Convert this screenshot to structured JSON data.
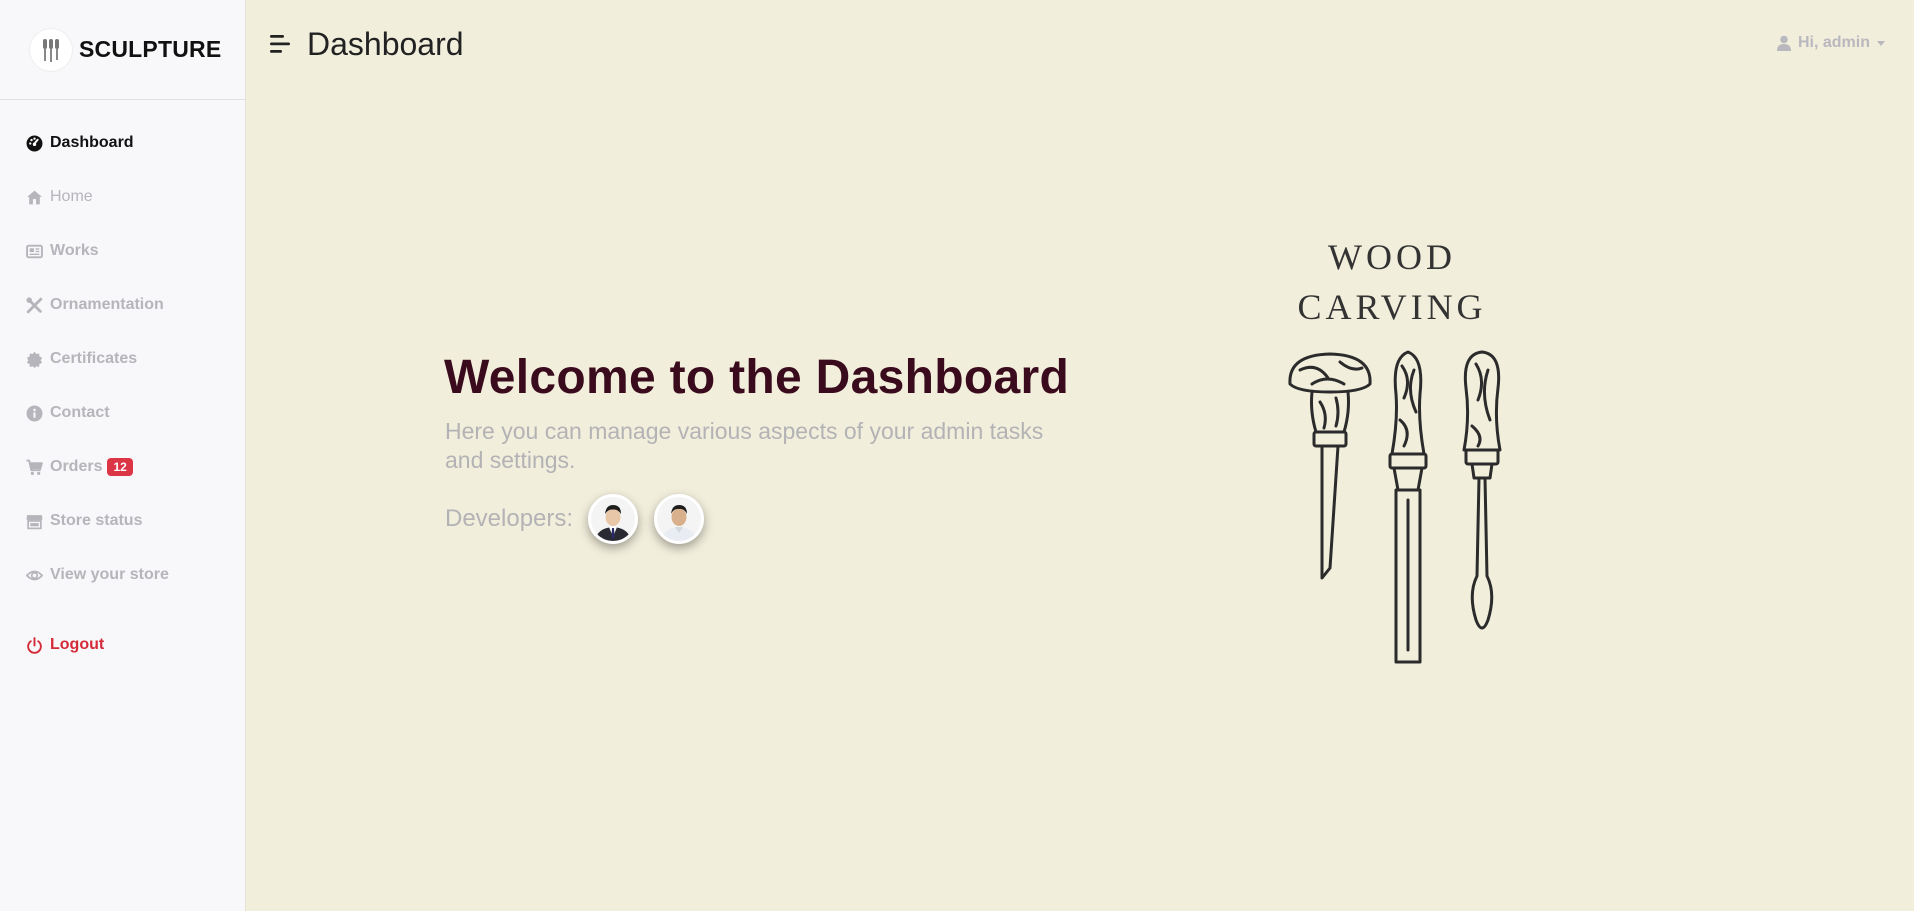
{
  "brand": {
    "name": "SCULPTURE"
  },
  "sidebar": {
    "items": [
      {
        "label": "Dashboard",
        "icon": "gauge-icon"
      },
      {
        "label": "Home",
        "icon": "home-icon"
      },
      {
        "label": "Works",
        "icon": "newspaper-icon"
      },
      {
        "label": "Ornamentation",
        "icon": "tools-icon"
      },
      {
        "label": "Certificates",
        "icon": "certificate-icon"
      },
      {
        "label": "Contact",
        "icon": "info-icon"
      },
      {
        "label": "Orders",
        "icon": "cart-icon",
        "badge": "12"
      },
      {
        "label": "Store status",
        "icon": "store-icon"
      },
      {
        "label": "View your store",
        "icon": "eye-icon"
      }
    ],
    "logout": {
      "label": "Logout",
      "icon": "power-icon"
    }
  },
  "header": {
    "title": "Dashboard",
    "user_greeting": "Hi, admin"
  },
  "main": {
    "welcome_title": "Welcome to the Dashboard",
    "welcome_subtitle": "Here you can manage various aspects of your admin tasks and settings.",
    "developers_label": "Developers:",
    "illustration": {
      "line1": "WOOD",
      "line2": "CARVING"
    }
  },
  "colors": {
    "background": "#f2eedc",
    "sidebar": "#f8f8fa",
    "title": "#3a0b1d",
    "muted": "#b3b3b6",
    "badge": "#dc3545",
    "logout": "#d42b38"
  }
}
